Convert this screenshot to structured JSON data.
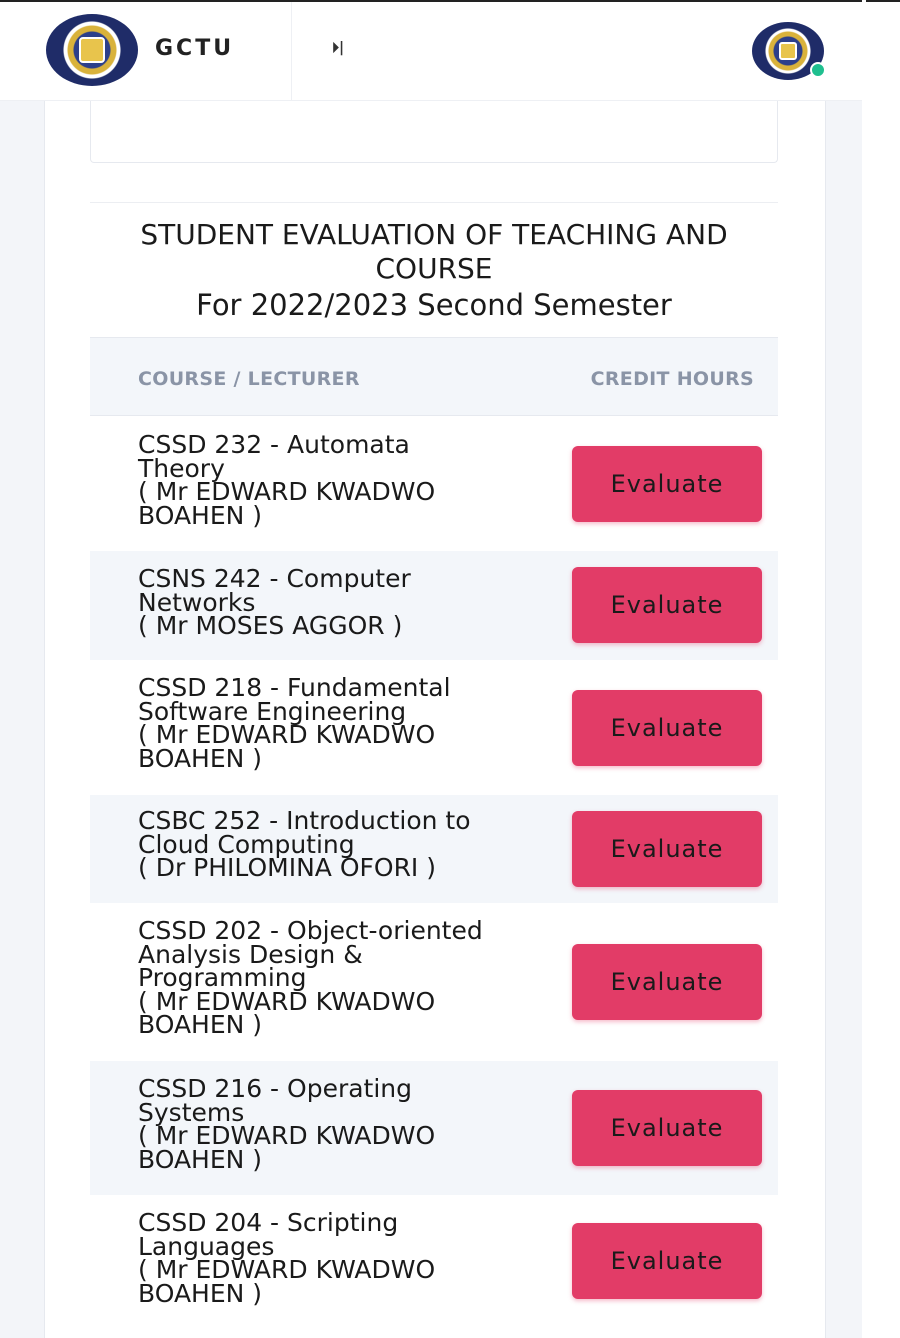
{
  "header": {
    "brand_name": "GCTU",
    "toggle_glyph": "⏵|",
    "logo_icon": "gctu-crest-logo",
    "avatar_icon": "user-avatar",
    "status_color": "#1fbf8f"
  },
  "evaluation": {
    "title_line1": "STUDENT EVALUATION OF TEACHING AND COURSE",
    "subtitle": "For 2022/2023 Second Semester",
    "columns": {
      "course": "COURSE / LECTURER",
      "credit": "CREDIT HOURS"
    },
    "button_color": "#e23c67",
    "courses": [
      {
        "lines": [
          "CSSD 232 - Automata",
          "Theory",
          "( Mr EDWARD KWADWO",
          "BOAHEN )"
        ],
        "button": "Evaluate"
      },
      {
        "lines": [
          "CSNS 242 - Computer",
          "Networks",
          "( Mr MOSES AGGOR )"
        ],
        "button": "Evaluate"
      },
      {
        "lines": [
          "CSSD 218 - Fundamental",
          "Software Engineering",
          "( Mr EDWARD KWADWO",
          "BOAHEN )"
        ],
        "button": "Evaluate"
      },
      {
        "lines": [
          "CSBC 252 - Introduction to",
          "Cloud Computing",
          "( Dr PHILOMINA OFORI )"
        ],
        "button": "Evaluate"
      },
      {
        "lines": [
          "CSSD 202 - Object-oriented",
          "Analysis Design &",
          "Programming",
          "( Mr EDWARD KWADWO",
          "BOAHEN )"
        ],
        "button": "Evaluate"
      },
      {
        "lines": [
          "CSSD 216 - Operating",
          "Systems",
          "( Mr EDWARD KWADWO",
          "BOAHEN )"
        ],
        "button": "Evaluate"
      },
      {
        "lines": [
          "CSSD 204 - Scripting",
          "Languages",
          "( Mr EDWARD KWADWO",
          "BOAHEN )"
        ],
        "button": "Evaluate"
      }
    ]
  }
}
